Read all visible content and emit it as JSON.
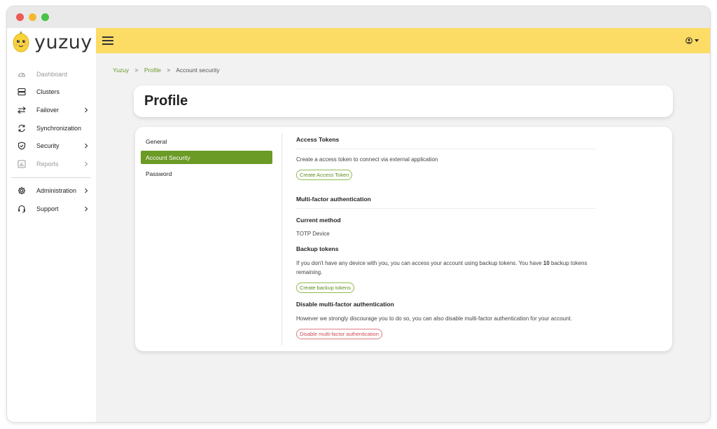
{
  "brand": {
    "name": "yuzuy"
  },
  "sidebar": {
    "items": [
      {
        "label": "Dashboard",
        "icon": "gauge-icon",
        "muted": true
      },
      {
        "label": "Clusters",
        "icon": "server-icon"
      },
      {
        "label": "Failover",
        "icon": "swap-arrows-icon",
        "chevron": true
      },
      {
        "label": "Synchronization",
        "icon": "sync-icon"
      },
      {
        "label": "Security",
        "icon": "shield-icon",
        "chevron": true
      },
      {
        "label": "Reports",
        "icon": "chart-icon",
        "chevron": true,
        "muted": true
      }
    ],
    "bottom_items": [
      {
        "label": "Administration",
        "icon": "gear-icon",
        "chevron": true
      },
      {
        "label": "Support",
        "icon": "headset-icon",
        "chevron": true
      }
    ]
  },
  "breadcrumb": {
    "home": "Yuzuy",
    "profile": "Profile",
    "current": "Account security",
    "separator": ">"
  },
  "page": {
    "title": "Profile"
  },
  "tabs": [
    "General",
    "Account Security",
    "Password"
  ],
  "access_tokens": {
    "title": "Access Tokens",
    "description": "Create a access token to connect via external application",
    "button": "Create Access Token"
  },
  "mfa": {
    "title": "Multi-factor authentication",
    "current_method_title": "Current method",
    "current_method_value": "TOTP Device",
    "backup_title": "Backup tokens",
    "backup_text_before": "If you don't have any device with you, you can access your account using backup tokens. You have ",
    "backup_count": "10",
    "backup_text_after": " backup tokens remaining.",
    "backup_button": "Create backup tokens",
    "disable_title": "Disable multi-factor authentication",
    "disable_text": "However we strongly discourage you to do so, you can also disable multi-factor authentication for your account.",
    "disable_button": "Disable multi-factor authentication"
  },
  "colors": {
    "accent": "#6b9a25",
    "topbar": "#fddc66",
    "danger": "#d24a52"
  }
}
